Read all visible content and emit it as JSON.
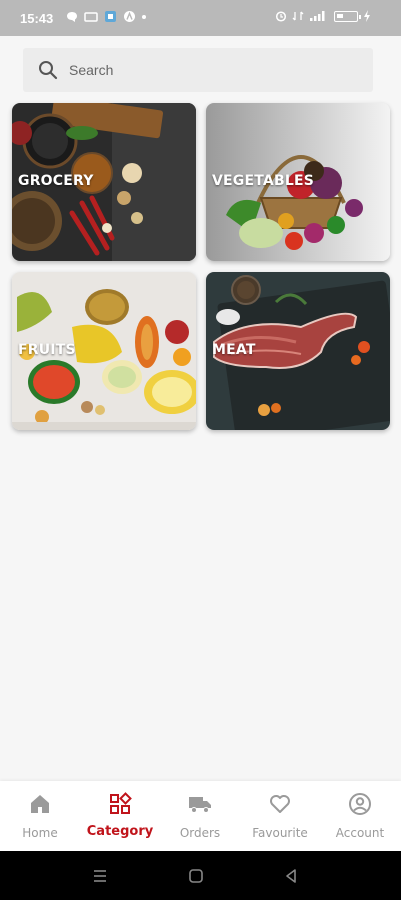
{
  "status_bar": {
    "time": "15:43",
    "left_icons": [
      "chat-bubble-icon",
      "notification-icon",
      "app-icon",
      "a-icon"
    ],
    "right_icons": [
      "alarm-icon",
      "data-icon",
      "signal-icon",
      "battery-icon",
      "charging-icon"
    ]
  },
  "search": {
    "placeholder": "Search",
    "value": ""
  },
  "categories": [
    {
      "label": "GROCERY"
    },
    {
      "label": "VEGETABLES"
    },
    {
      "label": "FRUITS"
    },
    {
      "label": "MEAT"
    }
  ],
  "bottom_nav": {
    "items": [
      {
        "label": "Home",
        "icon": "home-icon"
      },
      {
        "label": "Category",
        "icon": "category-grid-icon"
      },
      {
        "label": "Orders",
        "icon": "truck-icon"
      },
      {
        "label": "Favourite",
        "icon": "heart-icon"
      },
      {
        "label": "Account",
        "icon": "account-icon"
      }
    ],
    "active": "Category"
  },
  "colors": {
    "accent": "#c0141b",
    "inactive": "#9a9a9a",
    "background": "#f6f6f6"
  }
}
